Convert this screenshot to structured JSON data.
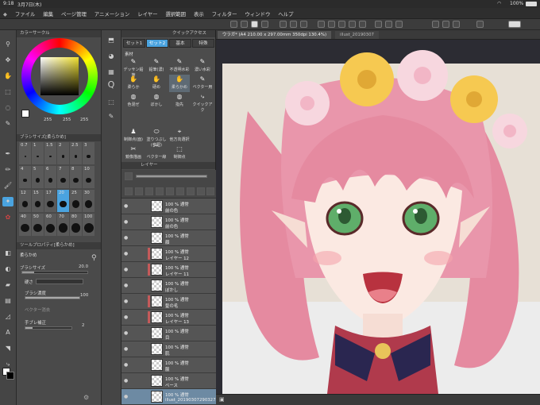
{
  "status": {
    "time": "9:18",
    "date": "3月7日(木)",
    "battery": "100%"
  },
  "menu": {
    "items": [
      "ファイル",
      "編集",
      "ページ管理",
      "アニメーション",
      "レイヤー",
      "選択範囲",
      "表示",
      "フィルター",
      "ウィンドウ",
      "ヘルプ"
    ]
  },
  "color_panel": {
    "title": "カラーサークル",
    "h": "255",
    "s": "255",
    "v": "255"
  },
  "brush_size_panel": {
    "title": "ブラシサイズ[柔らかめ]",
    "sizes": [
      "0.7",
      "1",
      "1.5",
      "2",
      "2.5",
      "3",
      "4",
      "5",
      "6",
      "7",
      "8",
      "10",
      "12",
      "15",
      "17",
      "20",
      "25",
      "30",
      "40",
      "50",
      "60",
      "70",
      "80",
      "100"
    ]
  },
  "tool_property": {
    "title": "ツールプロパティ[柔らかめ]",
    "subtitle": "柔らかめ",
    "brush_size_label": "ブラシサイズ",
    "brush_size_value": "20.0",
    "hardness_label": "硬さ",
    "density_label": "ブラシ濃度",
    "density_value": "100",
    "vector_label": "ベクター消去",
    "stabilization_label": "手ブレ補正",
    "stabilization_value": "2"
  },
  "subtool_panel": {
    "title": "クイックアクセス",
    "tabs": [
      "セット1",
      "セット2",
      "基本",
      "特殊"
    ],
    "section": "素材",
    "tools": [
      "デッサン鉛筆",
      "鉛筆(濃)",
      "不透明水彩",
      "濃い水彩",
      "柔らか",
      "硬め",
      "柔らかめ",
      "ベクター用",
      "色混ぜ",
      "ぼかし",
      "指先",
      "クイックアク",
      "",
      "",
      "",
      "",
      "制御点(面)",
      "塗りつぶし(参照)",
      "他方向選択",
      "",
      "鏡像描画",
      "ベクター線",
      "制御点"
    ]
  },
  "layer_panel": {
    "title": "レイヤー",
    "layers": [
      {
        "mode": "100 % 通常",
        "name": "前の色"
      },
      {
        "mode": "100 % 通常",
        "name": "前の色"
      },
      {
        "mode": "100 % 通常",
        "name": "顔"
      },
      {
        "mode": "100 % 通常",
        "name": "レイヤー 12"
      },
      {
        "mode": "100 % 通常",
        "name": "レイヤー 11"
      },
      {
        "mode": "100 % 通常",
        "name": "ぼかし"
      },
      {
        "mode": "100 % 通常",
        "name": "髪の毛"
      },
      {
        "mode": "100 % 通常",
        "name": "レイヤー 13"
      },
      {
        "mode": "100 % 通常",
        "name": "目"
      },
      {
        "mode": "100 % 通常",
        "name": "肌"
      },
      {
        "mode": "100 % 通常",
        "name": "服"
      },
      {
        "mode": "100 % 通常",
        "name": "ベース"
      },
      {
        "mode": "100 % 通常",
        "name": "illust_2019030729032734.8"
      }
    ]
  },
  "canvas": {
    "tab_title": "ウラガ* (A4 210.00 x 297.00mm 350dpi 130.4%)",
    "tab2": "illust_20190307"
  },
  "colors": {
    "accent": "#4aa3df",
    "hair": "#e88aa0",
    "eye": "#5fae6a",
    "flower_white": "#f7d7df",
    "flower_yellow": "#f6c951"
  }
}
